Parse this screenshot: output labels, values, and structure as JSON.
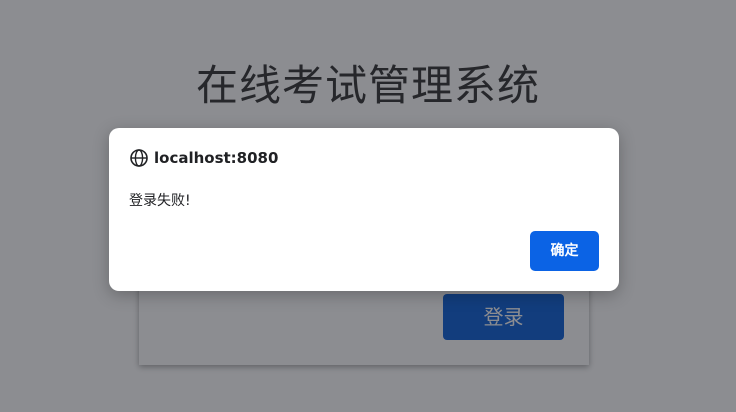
{
  "page": {
    "title": "在线考试管理系统"
  },
  "login": {
    "submit_label": "登录"
  },
  "dialog": {
    "origin": "localhost:8080",
    "icon": "globe-icon",
    "message": "登录失败!",
    "ok_label": "确定"
  },
  "colors": {
    "primary": "#0b63e5",
    "overlay": "rgba(26,28,36,0.5)"
  }
}
